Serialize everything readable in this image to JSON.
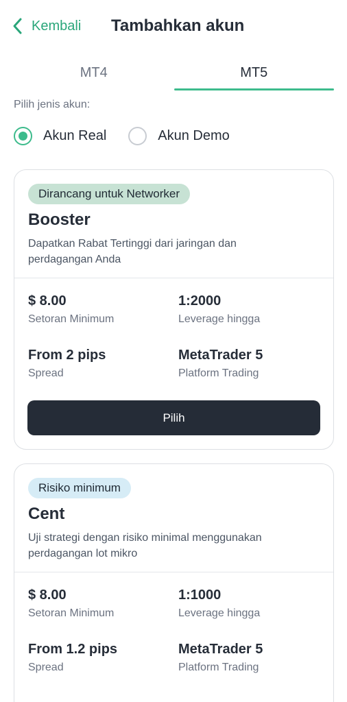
{
  "header": {
    "back_label": "Kembali",
    "title": "Tambahkan akun"
  },
  "tabs": [
    {
      "label": "MT4",
      "active": false
    },
    {
      "label": "MT5",
      "active": true
    }
  ],
  "account_type": {
    "label": "Pilih jenis akun:",
    "options": [
      {
        "label": "Akun Real",
        "selected": true
      },
      {
        "label": "Akun Demo",
        "selected": false
      }
    ]
  },
  "cards": [
    {
      "tag": "Dirancang untuk Networker",
      "name": "Booster",
      "description": "Dapatkan Rabat Tertinggi dari jaringan dan perdagangan Anda",
      "stats": [
        {
          "value": "$ 8.00",
          "label": "Setoran Minimum"
        },
        {
          "value": "1:2000",
          "label": "Leverage hingga"
        },
        {
          "value": "From 2 pips",
          "label": "Spread"
        },
        {
          "value": "MetaTrader 5",
          "label": "Platform Trading"
        }
      ],
      "button_label": "Pilih"
    },
    {
      "tag": "Risiko minimum",
      "name": "Cent",
      "description": "Uji strategi dengan risiko minimal menggunakan perdagangan lot mikro",
      "stats": [
        {
          "value": "$ 8.00",
          "label": "Setoran Minimum"
        },
        {
          "value": "1:1000",
          "label": "Leverage hingga"
        },
        {
          "value": "From 1.2 pips",
          "label": "Spread"
        },
        {
          "value": "MetaTrader 5",
          "label": "Platform Trading"
        }
      ]
    }
  ],
  "colors": {
    "accent": "#3dbb8c",
    "back_link": "#2aa67a",
    "button_bg": "#252c37",
    "tag_green": "#c7e2d4",
    "tag_blue": "#d6ecf6"
  },
  "icons": {
    "back": "chevron-left-icon"
  }
}
